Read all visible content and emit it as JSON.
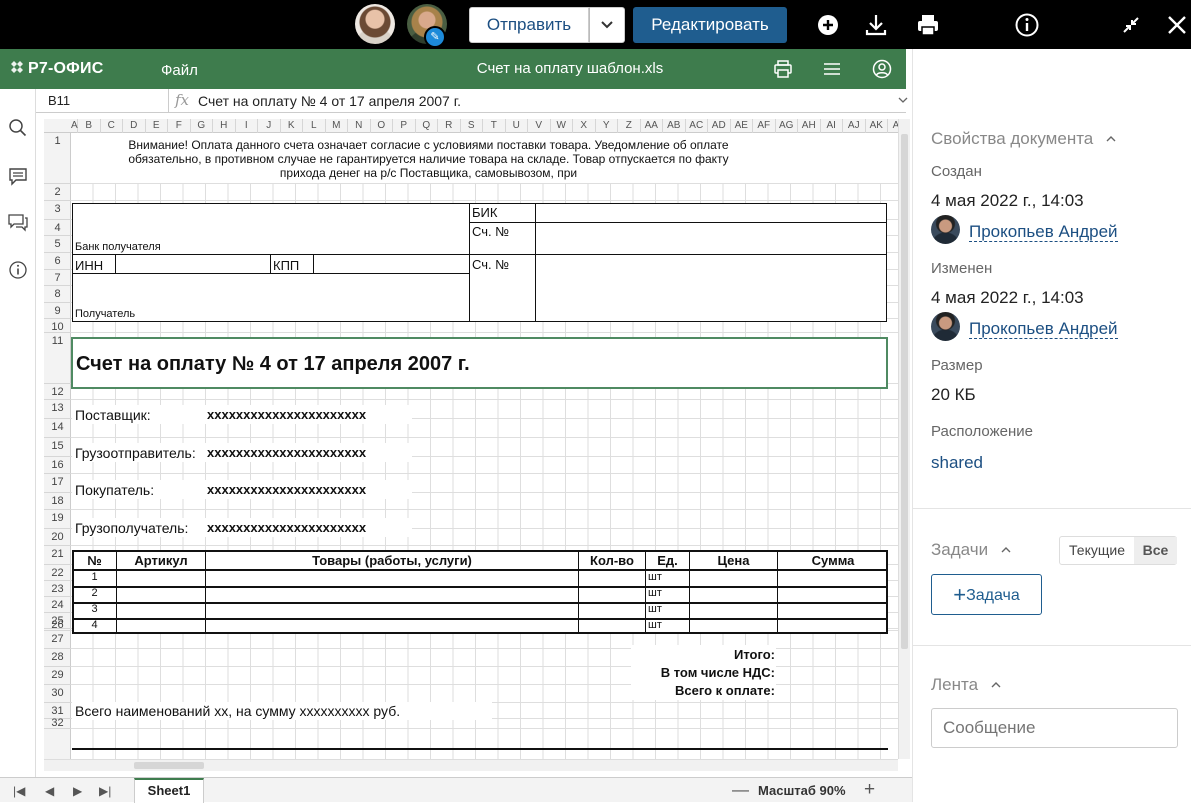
{
  "topbar": {
    "send_label": "Отправить",
    "edit_label": "Редактировать",
    "icons": [
      "plus-circle-icon",
      "download-icon",
      "print-icon",
      "info-icon",
      "collapse-icon",
      "close-icon"
    ]
  },
  "editor": {
    "logo": "Р7-ОФИС",
    "menu_file": "Файл",
    "doc_title": "Счет на оплату шаблон.xls",
    "cell_ref": "B11",
    "formula": "Счет на оплату № 4 от 17 апреля 2007 г.",
    "columns": [
      "A",
      "B",
      "C",
      "D",
      "E",
      "F",
      "G",
      "H",
      "I",
      "J",
      "K",
      "L",
      "M",
      "N",
      "O",
      "P",
      "Q",
      "R",
      "S",
      "T",
      "U",
      "V",
      "W",
      "X",
      "Y",
      "Z",
      "AA",
      "AB",
      "AC",
      "AD",
      "AE",
      "AF",
      "AG",
      "AH",
      "AI",
      "AJ",
      "AK",
      "AL"
    ],
    "rows": [
      "1",
      "2",
      "3",
      "4",
      "5",
      "6",
      "7",
      "8",
      "9",
      "10",
      "11",
      "12",
      "13",
      "14",
      "15",
      "16",
      "17",
      "18",
      "19",
      "20",
      "21",
      "22",
      "23",
      "24",
      "25",
      "26",
      "27",
      "28",
      "29",
      "30",
      "31",
      "32"
    ],
    "sheet_tab": "Sheet1",
    "zoom_label": "Масштаб 90%"
  },
  "sheet": {
    "notice_line1": "Внимание! Оплата данного счета означает согласие с условиями поставки товара. Уведомление об оплате",
    "notice_line2": "обязательно, в противном случае не гарантируется наличие товара на складе. Товар отпускается по факту",
    "notice_line3": "прихода денег на р/с Поставщика, самовывозом, при",
    "bik": "БИК",
    "acc1": "Сч. №",
    "acc2": "Сч. №",
    "bank": "Банк получателя",
    "inn": "ИНН",
    "kpp": "КПП",
    "recipient": "Получатель",
    "title": "Счет на оплату № 4 от 17 апреля 2007 г.",
    "supplier_label": "Поставщик:",
    "supplier_value": "xxxxxxxxxxxxxxxxxxxxxx",
    "shipper_label": "Грузоотправитель:",
    "shipper_value": "xxxxxxxxxxxxxxxxxxxxxx",
    "buyer_label": "Покупатель:",
    "buyer_value": "xxxxxxxxxxxxxxxxxxxxxx",
    "consignee_label": "Грузополучатель:",
    "consignee_value": "xxxxxxxxxxxxxxxxxxxxxx",
    "table_headers": [
      "№",
      "Артикул",
      "Товары (работы, услуги)",
      "Кол-во",
      "Ед.",
      "Цена",
      "Сумма"
    ],
    "table_rows": [
      {
        "n": "1",
        "unit": "шт"
      },
      {
        "n": "2",
        "unit": "шт"
      },
      {
        "n": "3",
        "unit": "шт"
      },
      {
        "n": "4",
        "unit": "шт"
      }
    ],
    "total": "Итого:",
    "vat": "В том числе НДС:",
    "grand_total": "Всего к оплате:",
    "summary": "Всего наименований xx, на сумму xxxxxxxxxx руб."
  },
  "panel": {
    "props_title": "Свойства документа",
    "created_label": "Создан",
    "created_value": "4 мая 2022 г., 14:03",
    "created_by": "Прокопьев Андрей",
    "modified_label": "Изменен",
    "modified_value": "4 мая 2022 г., 14:03",
    "modified_by": "Прокопьев Андрей",
    "size_label": "Размер",
    "size_value": "20 КБ",
    "location_label": "Расположение",
    "location_value": "shared",
    "tasks_title": "Задачи",
    "filter_current": "Текущие",
    "filter_all": "Все",
    "add_task": "Задача",
    "feed_title": "Лента",
    "message_placeholder": "Сообщение"
  }
}
